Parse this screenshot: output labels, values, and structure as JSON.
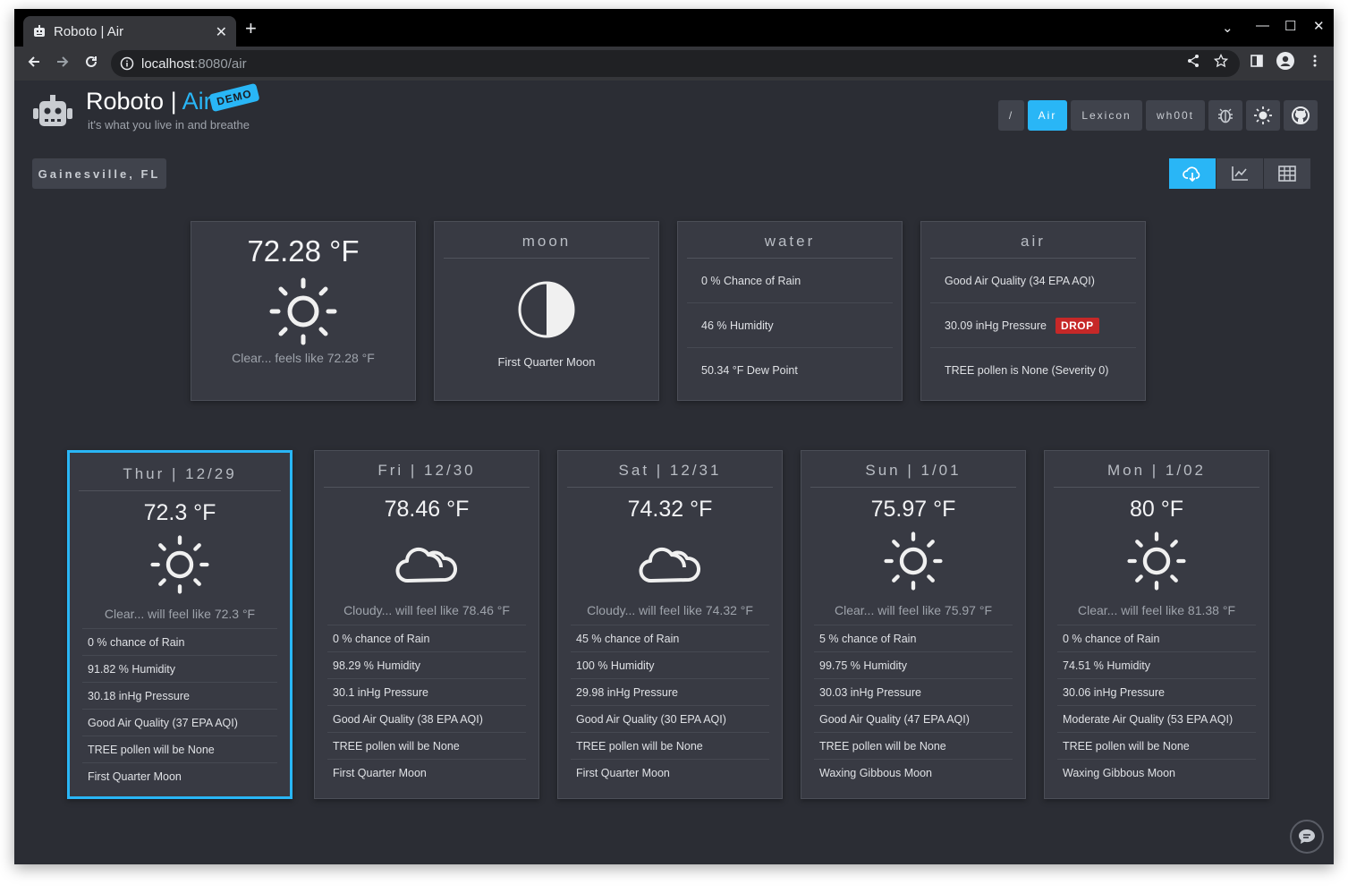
{
  "browser": {
    "tab_title": "Roboto | Air",
    "url_host": "localhost",
    "url_path": ":8080/air",
    "close_glyph": "✕",
    "newtab_glyph": "+",
    "minimize_glyph": "—",
    "maximize_glyph": "☐",
    "winclose_glyph": "✕",
    "dropdown_glyph": "⌄"
  },
  "header": {
    "brand_name": "Roboto",
    "brand_sep": " | ",
    "brand_app": "Air",
    "demo_badge": "DEMO",
    "tagline": "it's what you live in and breathe",
    "nav": {
      "root": "/",
      "air": "Air",
      "lexicon": "Lexicon",
      "whoot": "wh00t"
    }
  },
  "location": "Gainesville, FL",
  "current": {
    "temp": "72.28 °F",
    "description": "Clear... feels like 72.28 °F",
    "icon": "sun-icon"
  },
  "moon": {
    "title": "moon",
    "phase": "First Quarter Moon",
    "icon": "half-moon-icon"
  },
  "water": {
    "title": "water",
    "rows": [
      "0 % Chance of Rain",
      "46 % Humidity",
      "50.34 °F Dew Point"
    ]
  },
  "air": {
    "title": "air",
    "quality": "Good Air Quality (34 EPA AQI)",
    "pressure": "30.09 inHg Pressure",
    "pressure_badge": "DROP",
    "pollen": "TREE pollen is None (Severity 0)"
  },
  "forecast": [
    {
      "day": "Thur | 12/29",
      "temp": "72.3 °F",
      "icon": "sun-icon",
      "description": "Clear... will feel like 72.3 °F",
      "rows": [
        "0 % chance of Rain",
        "91.82 % Humidity",
        "30.18 inHg Pressure",
        "Good Air Quality (37 EPA AQI)",
        "TREE pollen will be None",
        "First Quarter Moon"
      ]
    },
    {
      "day": "Fri | 12/30",
      "temp": "78.46 °F",
      "icon": "cloud-icon",
      "description": "Cloudy... will feel like 78.46 °F",
      "rows": [
        "0 % chance of Rain",
        "98.29 % Humidity",
        "30.1 inHg Pressure",
        "Good Air Quality (38 EPA AQI)",
        "TREE pollen will be None",
        "First Quarter Moon"
      ]
    },
    {
      "day": "Sat | 12/31",
      "temp": "74.32 °F",
      "icon": "cloud-icon",
      "description": "Cloudy... will feel like 74.32 °F",
      "rows": [
        "45 % chance of Rain",
        "100 % Humidity",
        "29.98 inHg Pressure",
        "Good Air Quality (30 EPA AQI)",
        "TREE pollen will be None",
        "First Quarter Moon"
      ]
    },
    {
      "day": "Sun | 1/01",
      "temp": "75.97 °F",
      "icon": "sun-icon",
      "description": "Clear... will feel like 75.97 °F",
      "rows": [
        "5 % chance of Rain",
        "99.75 % Humidity",
        "30.03 inHg Pressure",
        "Good Air Quality (47 EPA AQI)",
        "TREE pollen will be None",
        "Waxing Gibbous Moon"
      ]
    },
    {
      "day": "Mon | 1/02",
      "temp": "80 °F",
      "icon": "sun-icon",
      "description": "Clear... will feel like 81.38 °F",
      "rows": [
        "0 % chance of Rain",
        "74.51 % Humidity",
        "30.06 inHg Pressure",
        "Moderate Air Quality (53 EPA AQI)",
        "TREE pollen will be None",
        "Waxing Gibbous Moon"
      ]
    }
  ],
  "colors": {
    "accent": "#29b6f6",
    "background": "#2b2d34",
    "card": "#383a43",
    "drop_badge": "#c62828"
  }
}
